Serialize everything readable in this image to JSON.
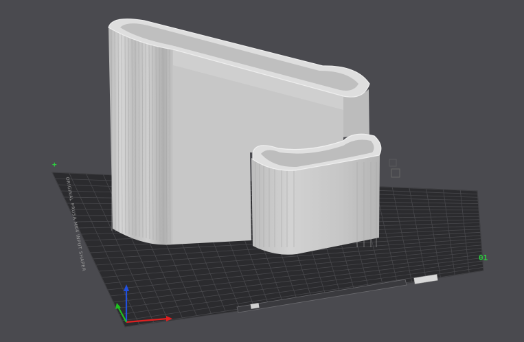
{
  "viewport": {
    "background_color": "#4a4a4f",
    "bed_color": "#2b2b2e",
    "grid_color": "#4a4a4e",
    "model_color": "#c9c9c9"
  },
  "bed": {
    "corner_label_left": "+",
    "corner_label_right": "01",
    "side_text": "ORIGINAL PRUSA MK4 INPUT SHAPER",
    "corner_label_color": "#2ecc40"
  },
  "axes": {
    "x_color": "#e02020",
    "y_color": "#20c020",
    "z_color": "#2050e0",
    "icons": [
      "x-axis-icon",
      "y-axis-icon",
      "z-axis-icon"
    ]
  }
}
